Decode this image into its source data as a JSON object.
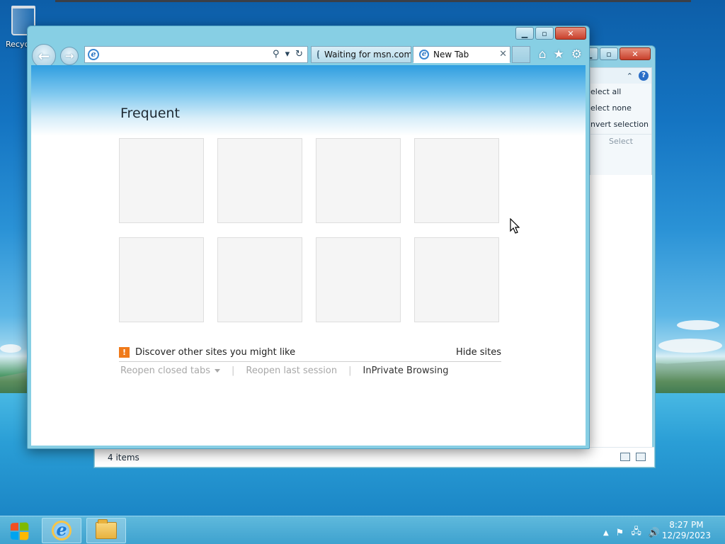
{
  "desktop": {
    "recycle_bin_label": "Recycle Bin"
  },
  "explorer": {
    "ribbon": {
      "commands": [
        "elect all",
        "elect none",
        "nvert selection"
      ],
      "group_label": "Select"
    },
    "status": {
      "item_count": "4 items"
    }
  },
  "ie": {
    "address": {
      "value": "",
      "placeholder": ""
    },
    "tabs": [
      {
        "label": "Waiting for msn.com",
        "state": "loading"
      },
      {
        "label": "New Tab",
        "state": "active"
      }
    ],
    "new_tab": {
      "section_title": "Frequent",
      "tile_count": 8,
      "discover_text": "Discover other sites you might like",
      "hide_sites": "Hide sites",
      "links": {
        "reopen_closed_tabs": "Reopen closed tabs",
        "reopen_last_session": "Reopen last session",
        "inprivate": "InPrivate Browsing"
      }
    }
  },
  "taskbar": {
    "clock": {
      "time": "8:27 PM",
      "date": "12/29/2023"
    }
  },
  "colors": {
    "ie_frame": "#87cfe4",
    "close_button": "#c8402b",
    "taskbar": "#3ea2cf",
    "discover_bulb": "#f07a1a"
  },
  "icons": {
    "search": "magnifier",
    "refresh": "circular-arrow",
    "home": "house",
    "favorites": "star",
    "settings": "gear"
  }
}
